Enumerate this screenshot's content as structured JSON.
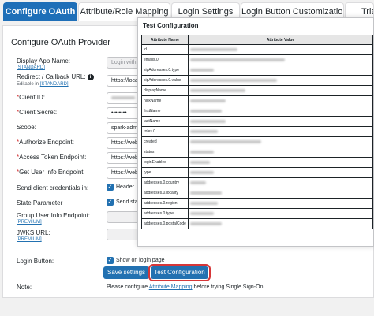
{
  "tabs": [
    {
      "label": "Configure OAuth",
      "active": true
    },
    {
      "label": "Attribute/Role Mapping",
      "active": false
    },
    {
      "label": "Login Settings",
      "active": false
    },
    {
      "label": "Login Button Customization",
      "active": false
    },
    {
      "label": "Trial",
      "active": false
    }
  ],
  "provider": {
    "title": "Configure OAuth Provider",
    "display_app_name": {
      "label": "Display App Name:",
      "tag": "[STANDARD]",
      "value": "Login with"
    },
    "redirect_url": {
      "label": "Redirect / Callback URL:",
      "note_prefix": "Editable in ",
      "tag": "[STANDARD]",
      "value": "https://local"
    },
    "client_id": {
      "label": "Client ID:",
      "req": "*"
    },
    "client_secret": {
      "label": "Client Secret:",
      "req": "*",
      "value": "••••••••"
    },
    "scope": {
      "label": "Scope:",
      "value": "spark-admi"
    },
    "authorize_endpoint": {
      "label": "Authorize Endpoint:",
      "req": "*",
      "value": "https://web"
    },
    "access_token_endpoint": {
      "label": "Access Token Endpoint:",
      "req": "*",
      "value": "https://web"
    },
    "get_user_info_endpoint": {
      "label": "Get User Info Endpoint:",
      "req": "*",
      "value": "https://web"
    },
    "send_credentials": {
      "label": "Send client credentials in:",
      "option": "Header"
    },
    "state_parameter": {
      "label": "State Parameter :",
      "option": "Send state"
    },
    "group_user_info_endpoint": {
      "label": "Group User Info Endpoint:",
      "tag": "[PREMIUM]"
    },
    "jwks_url": {
      "label": "JWKS URL:",
      "tag": "[PREMIUM]"
    },
    "login_button": {
      "label": "Login Button:",
      "option": "Show on login page"
    },
    "save_button": "Save settings",
    "test_button": "Test Configuration",
    "note": {
      "label": "Note:",
      "text_before": "Please configure ",
      "link": "Attribute Mapping",
      "text_after": " before trying Single Sign-On."
    }
  },
  "test_popup": {
    "title": "Test Configuration",
    "headers": [
      "Attribute Name",
      "Attribute Value"
    ],
    "attributes": [
      "id",
      "emails.0",
      "sipAddresses.0.type",
      "sipAddresses.0.value",
      "displayName",
      "nickName",
      "firstName",
      "lastName",
      "roles.0",
      "created",
      "status",
      "loginEnabled",
      "type",
      "addresses.0.country",
      "addresses.0.locality",
      "addresses.0.region",
      "addresses.0.type",
      "addresses.0.postalCode"
    ]
  },
  "colors": {
    "accent": "#2271b1",
    "tab_active": "#1e6fb8",
    "highlight": "#d63638"
  }
}
